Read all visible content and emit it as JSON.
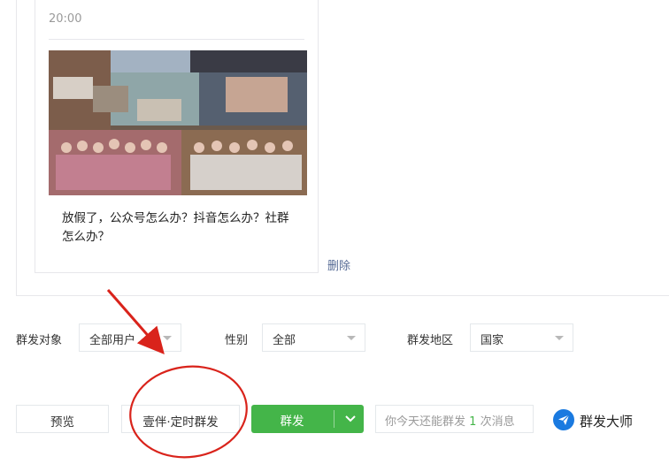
{
  "article": {
    "time": "20:00",
    "text": "放假了，公众号怎么办？抖音怎么办？社群怎么办？",
    "delete_label": "删除"
  },
  "filters": {
    "target_label": "群发对象",
    "target_value": "全部用户",
    "gender_label": "性别",
    "gender_value": "全部",
    "region_label": "群发地区",
    "region_value": "国家"
  },
  "actions": {
    "preview_label": "预览",
    "schedule_label": "壹伴·定时群发",
    "send_label": "群发",
    "quota_prefix": "你今天还能群发",
    "quota_count": "1",
    "quota_suffix": "次消息",
    "master_label": "群发大师"
  },
  "colors": {
    "primary_green": "#44b549",
    "link_blue": "#576b95",
    "annotation_red": "#d9231b",
    "master_blue": "#1a7ae0"
  },
  "icons": {
    "dropdown": "chevron-down-icon",
    "master": "paper-plane-icon"
  }
}
